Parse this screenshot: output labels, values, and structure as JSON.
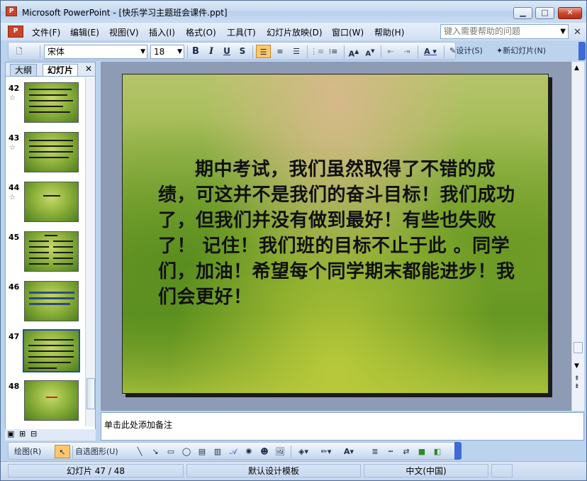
{
  "window": {
    "title": "Microsoft PowerPoint - [快乐学习主题班会课件.ppt]",
    "app_icon": "powerpoint-icon",
    "controls": [
      "minimize",
      "maximize",
      "close"
    ]
  },
  "menu": {
    "items": [
      "文件(F)",
      "编辑(E)",
      "视图(V)",
      "插入(I)",
      "格式(O)",
      "工具(T)",
      "幻灯片放映(D)",
      "窗口(W)",
      "帮助(H)"
    ],
    "help_placeholder": "键入需要帮助的问题"
  },
  "toolbar": {
    "font_name": "宋体",
    "font_size": "18",
    "bold": "B",
    "italic": "I",
    "underline": "U",
    "shadow": "S",
    "design_label": "设计(S)",
    "new_slide_label": "新幻灯片(N)"
  },
  "left_pane": {
    "tabs": [
      "大纲",
      "幻灯片"
    ],
    "selected_tab": "幻灯片",
    "thumbnails": [
      {
        "number": "42",
        "animated": true
      },
      {
        "number": "43",
        "animated": true
      },
      {
        "number": "44",
        "animated": true
      },
      {
        "number": "45",
        "animated": false
      },
      {
        "number": "46",
        "animated": false
      },
      {
        "number": "47",
        "animated": false,
        "selected": true
      },
      {
        "number": "48",
        "animated": false
      }
    ]
  },
  "slide": {
    "body_text": "期中考试，我们虽然取得了不错的成绩，可这并不是我们的奋斗目标！我们成功了，但我们并没有做到最好！有些也失败了！ 记住！我们班的目标不止于此 。同学们，加油！希望每个同学期末都能进步！我们会更好！"
  },
  "notes": {
    "placeholder": "单击此处添加备注"
  },
  "drawing_toolbar": {
    "draw_label": "绘图(R)",
    "autoshapes_label": "自选图形(U)"
  },
  "status": {
    "slide_position": "幻灯片 47 / 48",
    "template": "默认设计模板",
    "language": "中文(中国)"
  }
}
